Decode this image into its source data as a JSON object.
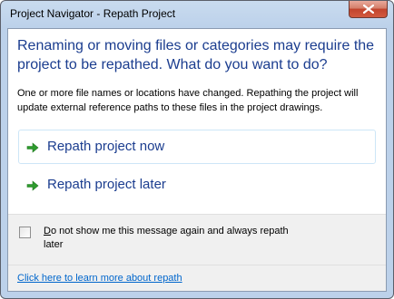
{
  "window": {
    "title": "Project Navigator - Repath Project",
    "close_icon": "close-icon"
  },
  "dialog": {
    "heading": "Renaming or moving files or categories may require the project to be repathed. What do you want to do?",
    "description": "One or more file names or locations have changed. Repathing the project will update external reference paths to these files in the project drawings.",
    "commands": [
      {
        "label": "Repath project now",
        "icon": "green-arrow-right-icon",
        "highlighted": true
      },
      {
        "label": "Repath project later",
        "icon": "green-arrow-right-icon",
        "highlighted": false
      }
    ],
    "checkbox": {
      "label_first_char": "D",
      "label_rest": "o not show me this message again and always repath later",
      "checked": false
    },
    "footer_link": "Click here to learn more about repath"
  },
  "colors": {
    "heading": "#1b3d8f",
    "arrow_green": "#2e9b2e",
    "link": "#0066cc"
  }
}
